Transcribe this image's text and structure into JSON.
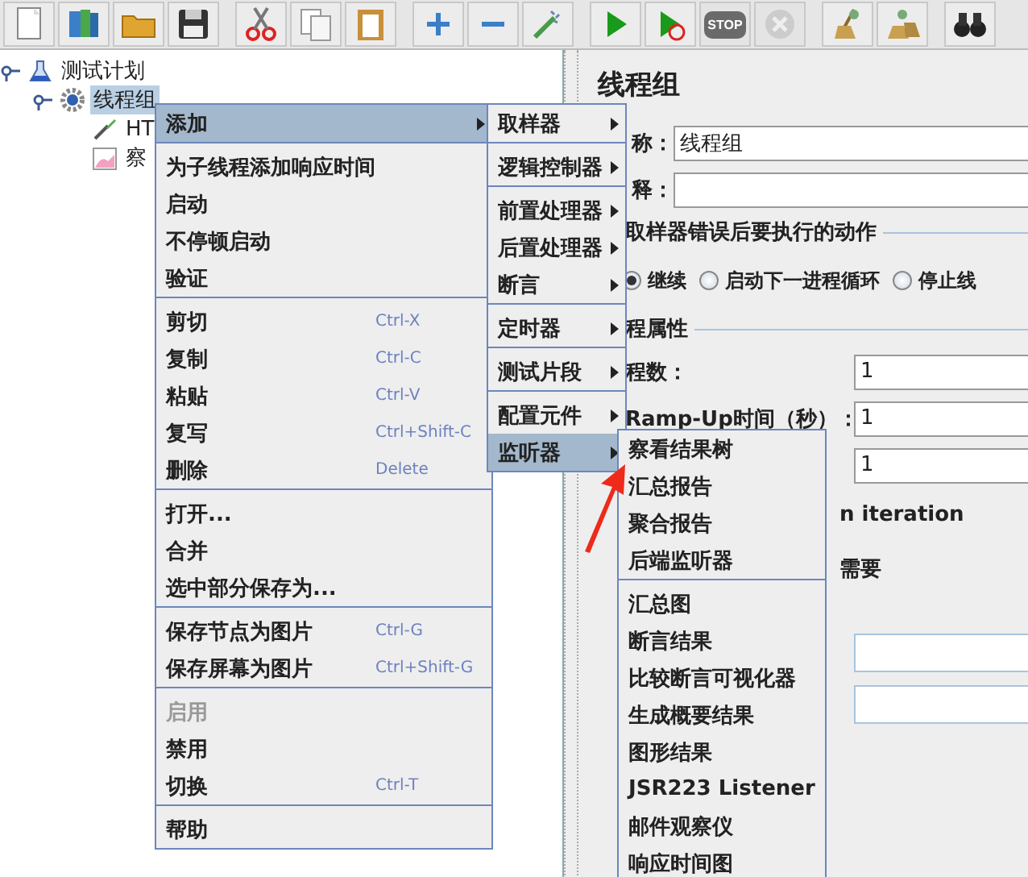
{
  "toolbar": [
    {
      "kind": "new",
      "disabled": false
    },
    {
      "kind": "templates",
      "disabled": false
    },
    {
      "kind": "open",
      "disabled": false
    },
    {
      "kind": "save",
      "disabled": false
    },
    {
      "kind": "cut",
      "disabled": false
    },
    {
      "kind": "copy",
      "disabled": false
    },
    {
      "kind": "paste",
      "disabled": false
    },
    {
      "kind": "add",
      "disabled": false
    },
    {
      "kind": "remove",
      "disabled": false
    },
    {
      "kind": "toggle",
      "disabled": false
    },
    {
      "kind": "start",
      "disabled": false
    },
    {
      "kind": "start_no_pause",
      "disabled": false
    },
    {
      "kind": "stop",
      "label": "STOP",
      "disabled": true
    },
    {
      "kind": "shutdown",
      "disabled": true
    },
    {
      "kind": "clear",
      "disabled": false
    },
    {
      "kind": "clear_all",
      "disabled": false
    },
    {
      "kind": "search",
      "disabled": false
    }
  ],
  "tree": [
    {
      "label": "测试计划",
      "kind": "plan",
      "selected": false,
      "children": [
        {
          "label": "线程组",
          "kind": "thread_group",
          "selected": true,
          "children": [
            {
              "label": "HT",
              "kind": "sampler",
              "selected": false
            },
            {
              "label": "察",
              "kind": "listener",
              "selected": false
            }
          ]
        }
      ]
    }
  ],
  "panel": {
    "title": "线程组",
    "fields": [
      {
        "label": "称：",
        "value": "线程组"
      },
      {
        "label": "释："
      }
    ],
    "error_action": {
      "title": "取样器错误后要执行的动作",
      "options": [
        {
          "label": "继续",
          "selected": true
        },
        {
          "label": "启动下一进程循环",
          "selected": false
        },
        {
          "label": "停止线",
          "selected": false
        }
      ]
    },
    "thread_properties": {
      "title": "程属性",
      "fields": [
        {
          "label": "程数：",
          "value": "1"
        },
        {
          "label": "Ramp-Up时间（秒）：",
          "value": "1"
        },
        {
          "value": "1"
        }
      ],
      "notes": [
        "n iteration",
        "需要"
      ],
      "extra_fields": [
        {
          "kind": "text"
        },
        {
          "kind": "text"
        }
      ]
    }
  },
  "context_menu": {
    "groups": [
      [
        {
          "label": "添加",
          "selected": true,
          "disabled": false,
          "has_submenu": true
        }
      ],
      [
        {
          "label": "为子线程添加响应时间",
          "selected": false,
          "disabled": false,
          "has_submenu": false
        },
        {
          "label": "启动",
          "selected": false,
          "disabled": false,
          "has_submenu": false
        },
        {
          "label": "不停顿启动",
          "selected": false,
          "disabled": false,
          "has_submenu": false
        },
        {
          "label": "验证",
          "selected": false,
          "disabled": false,
          "has_submenu": false
        }
      ],
      [
        {
          "label": "剪切",
          "shortcut": "Ctrl-X",
          "selected": false,
          "disabled": false,
          "has_submenu": false
        },
        {
          "label": "复制",
          "shortcut": "Ctrl-C",
          "selected": false,
          "disabled": false,
          "has_submenu": false
        },
        {
          "label": "粘贴",
          "shortcut": "Ctrl-V",
          "selected": false,
          "disabled": false,
          "has_submenu": false
        },
        {
          "label": "复写",
          "shortcut": "Ctrl+Shift-C",
          "selected": false,
          "disabled": false,
          "has_submenu": false
        },
        {
          "label": "删除",
          "shortcut": "Delete",
          "selected": false,
          "disabled": false,
          "has_submenu": false
        }
      ],
      [
        {
          "label": "打开...",
          "selected": false,
          "disabled": false,
          "has_submenu": false
        },
        {
          "label": "合并",
          "selected": false,
          "disabled": false,
          "has_submenu": false
        },
        {
          "label": "选中部分保存为...",
          "selected": false,
          "disabled": false,
          "has_submenu": false
        }
      ],
      [
        {
          "label": "保存节点为图片",
          "shortcut": "Ctrl-G",
          "selected": false,
          "disabled": false,
          "has_submenu": false
        },
        {
          "label": "保存屏幕为图片",
          "shortcut": "Ctrl+Shift-G",
          "selected": false,
          "disabled": false,
          "has_submenu": false
        }
      ],
      [
        {
          "label": "启用",
          "selected": false,
          "disabled": true,
          "has_submenu": false
        },
        {
          "label": "禁用",
          "selected": false,
          "disabled": false,
          "has_submenu": false
        },
        {
          "label": "切换",
          "shortcut": "Ctrl-T",
          "selected": false,
          "disabled": false,
          "has_submenu": false
        }
      ],
      [
        {
          "label": "帮助",
          "selected": false,
          "disabled": false,
          "has_submenu": false
        }
      ]
    ]
  },
  "add_submenu": {
    "groups": [
      [
        {
          "label": "取样器",
          "selected": false
        }
      ],
      [
        {
          "label": "逻辑控制器",
          "selected": false
        }
      ],
      [
        {
          "label": "前置处理器",
          "selected": false
        },
        {
          "label": "后置处理器",
          "selected": false
        },
        {
          "label": "断言",
          "selected": false
        }
      ],
      [
        {
          "label": "定时器",
          "selected": false
        }
      ],
      [
        {
          "label": "测试片段",
          "selected": false
        }
      ],
      [
        {
          "label": "配置元件",
          "selected": false
        },
        {
          "label": "监听器",
          "selected": true
        }
      ]
    ]
  },
  "listener_submenu": {
    "groups": [
      [
        {
          "label": "察看结果树",
          "selected": false
        },
        {
          "label": "汇总报告",
          "selected": false
        },
        {
          "label": "聚合报告",
          "selected": false
        },
        {
          "label": "后端监听器",
          "selected": false
        }
      ],
      [
        {
          "label": "汇总图",
          "selected": false
        },
        {
          "label": "断言结果",
          "selected": false
        },
        {
          "label": "比较断言可视化器",
          "selected": false
        },
        {
          "label": "生成概要结果",
          "selected": false
        },
        {
          "label": "图形结果",
          "selected": false
        },
        {
          "label": "JSR223 Listener",
          "selected": false
        },
        {
          "label": "邮件观察仪",
          "selected": false
        },
        {
          "label": "响应时间图",
          "selected": false
        }
      ]
    ]
  }
}
